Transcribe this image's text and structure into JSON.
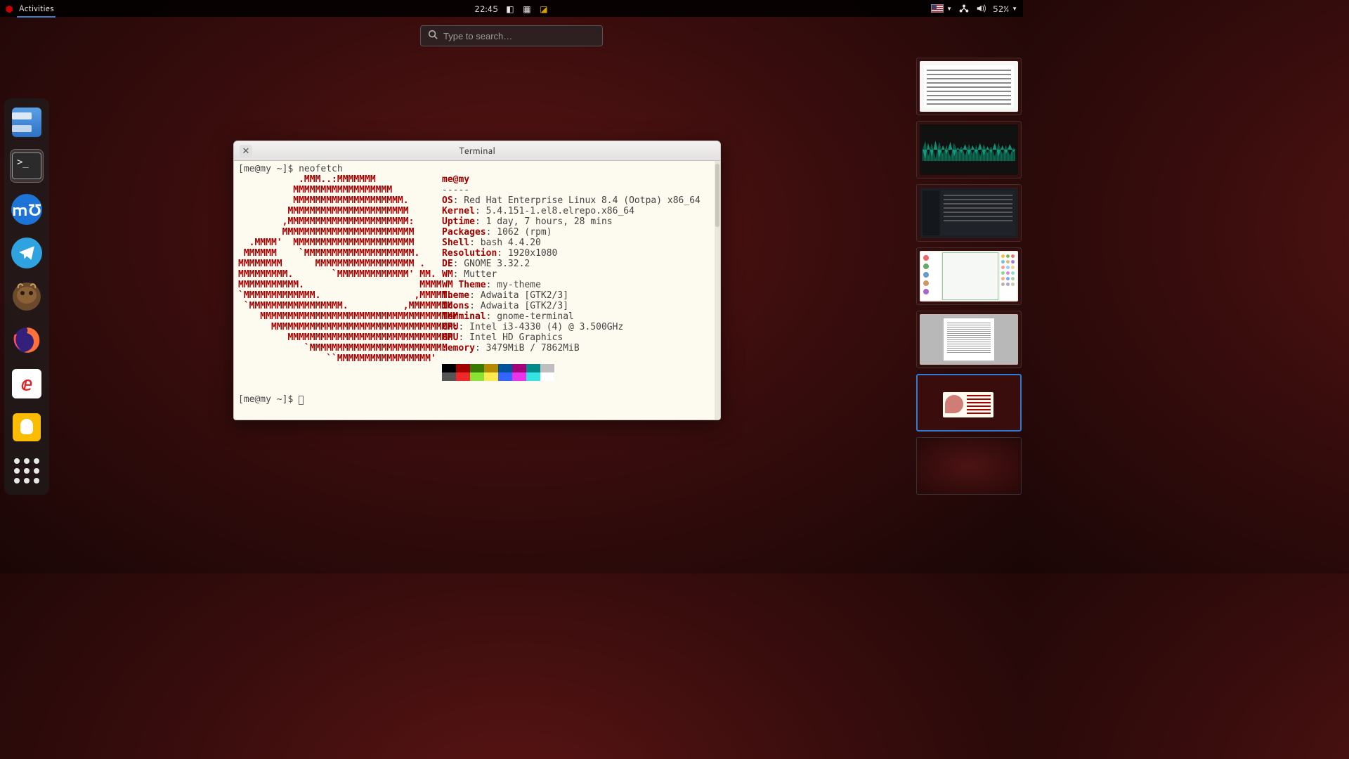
{
  "topbar": {
    "activities_label": "Activities",
    "clock": "22:45",
    "battery_pct": "52%"
  },
  "search": {
    "placeholder": "Type to search…"
  },
  "dock": {
    "items": [
      {
        "name": "files"
      },
      {
        "name": "terminal",
        "active": true
      },
      {
        "name": "musescore",
        "glyph": "mƱ"
      },
      {
        "name": "telegram"
      },
      {
        "name": "dbeaver"
      },
      {
        "name": "firefox"
      },
      {
        "name": "evince",
        "glyph": "ⅇ"
      },
      {
        "name": "keep"
      },
      {
        "name": "show-apps"
      }
    ]
  },
  "terminal": {
    "title": "Terminal",
    "prompt1": "[me@my ~]$ ",
    "command": "neofetch",
    "prompt2": "[me@my ~]$ ",
    "logo_lines": [
      "           .MMM..:MMMMMMM",
      "          MMMMMMMMMMMMMMMMMM",
      "          MMMMMMMMMMMMMMMMMMMM.",
      "         MMMMMMMMMMMMMMMMMMMMMM",
      "        ,MMMMMMMMMMMMMMMMMMMMMM:",
      "        MMMMMMMMMMMMMMMMMMMMMMMM",
      "  .MMMM'  MMMMMMMMMMMMMMMMMMMMMM",
      " MMMMMM    `MMMMMMMMMMMMMMMMMMMM.",
      "MMMMMMMM      MMMMMMMMMMMMMMMMMM .",
      "MMMMMMMMM.       `MMMMMMMMMMMMM' MM.",
      "MMMMMMMMMMM.                     MMMM",
      "`MMMMMMMMMMMMM.                 ,MMMMM.",
      " `MMMMMMMMMMMMMMMMM.          ,MMMMMMMM.",
      "    MMMMMMMMMMMMMMMMMMMMMMMMMMMMMMMMMMMM",
      "      MMMMMMMMMMMMMMMMMMMMMMMMMMMMMMMMM:",
      "         MMMMMMMMMMMMMMMMMMMMMMMMMMMMMM",
      "            `MMMMMMMMMMMMMMMMMMMMMMMM:",
      "                ``MMMMMMMMMMMMMMMMM'"
    ],
    "info": {
      "userhost": "me@my",
      "sep": "-----",
      "rows": [
        {
          "label": "OS",
          "value": "Red Hat Enterprise Linux 8.4 (Ootpa) x86_64"
        },
        {
          "label": "Kernel",
          "value": "5.4.151-1.el8.elrepo.x86_64"
        },
        {
          "label": "Uptime",
          "value": "1 day, 7 hours, 28 mins"
        },
        {
          "label": "Packages",
          "value": "1062 (rpm)"
        },
        {
          "label": "Shell",
          "value": "bash 4.4.20"
        },
        {
          "label": "Resolution",
          "value": "1920x1080"
        },
        {
          "label": "DE",
          "value": "GNOME 3.32.2"
        },
        {
          "label": "WM",
          "value": "Mutter"
        },
        {
          "label": "WM Theme",
          "value": "my-theme"
        },
        {
          "label": "Theme",
          "value": "Adwaita [GTK2/3]"
        },
        {
          "label": "Icons",
          "value": "Adwaita [GTK2/3]"
        },
        {
          "label": "Terminal",
          "value": "gnome-terminal"
        },
        {
          "label": "CPU",
          "value": "Intel i3-4330 (4) @ 3.500GHz"
        },
        {
          "label": "GPU",
          "value": "Intel HD Graphics"
        },
        {
          "label": "Memory",
          "value": "3479MiB / 7862MiB"
        }
      ],
      "palette_row1": [
        "#000000",
        "#a30000",
        "#397a00",
        "#b58900",
        "#00529b",
        "#a3007a",
        "#008a8a",
        "#bfbfbf"
      ],
      "palette_row2": [
        "#555555",
        "#ef2929",
        "#8ae234",
        "#fce94f",
        "#3465ff",
        "#e934e9",
        "#34e2e2",
        "#ffffff"
      ]
    }
  },
  "workspaces": {
    "count": 7,
    "selected_index": 5
  }
}
